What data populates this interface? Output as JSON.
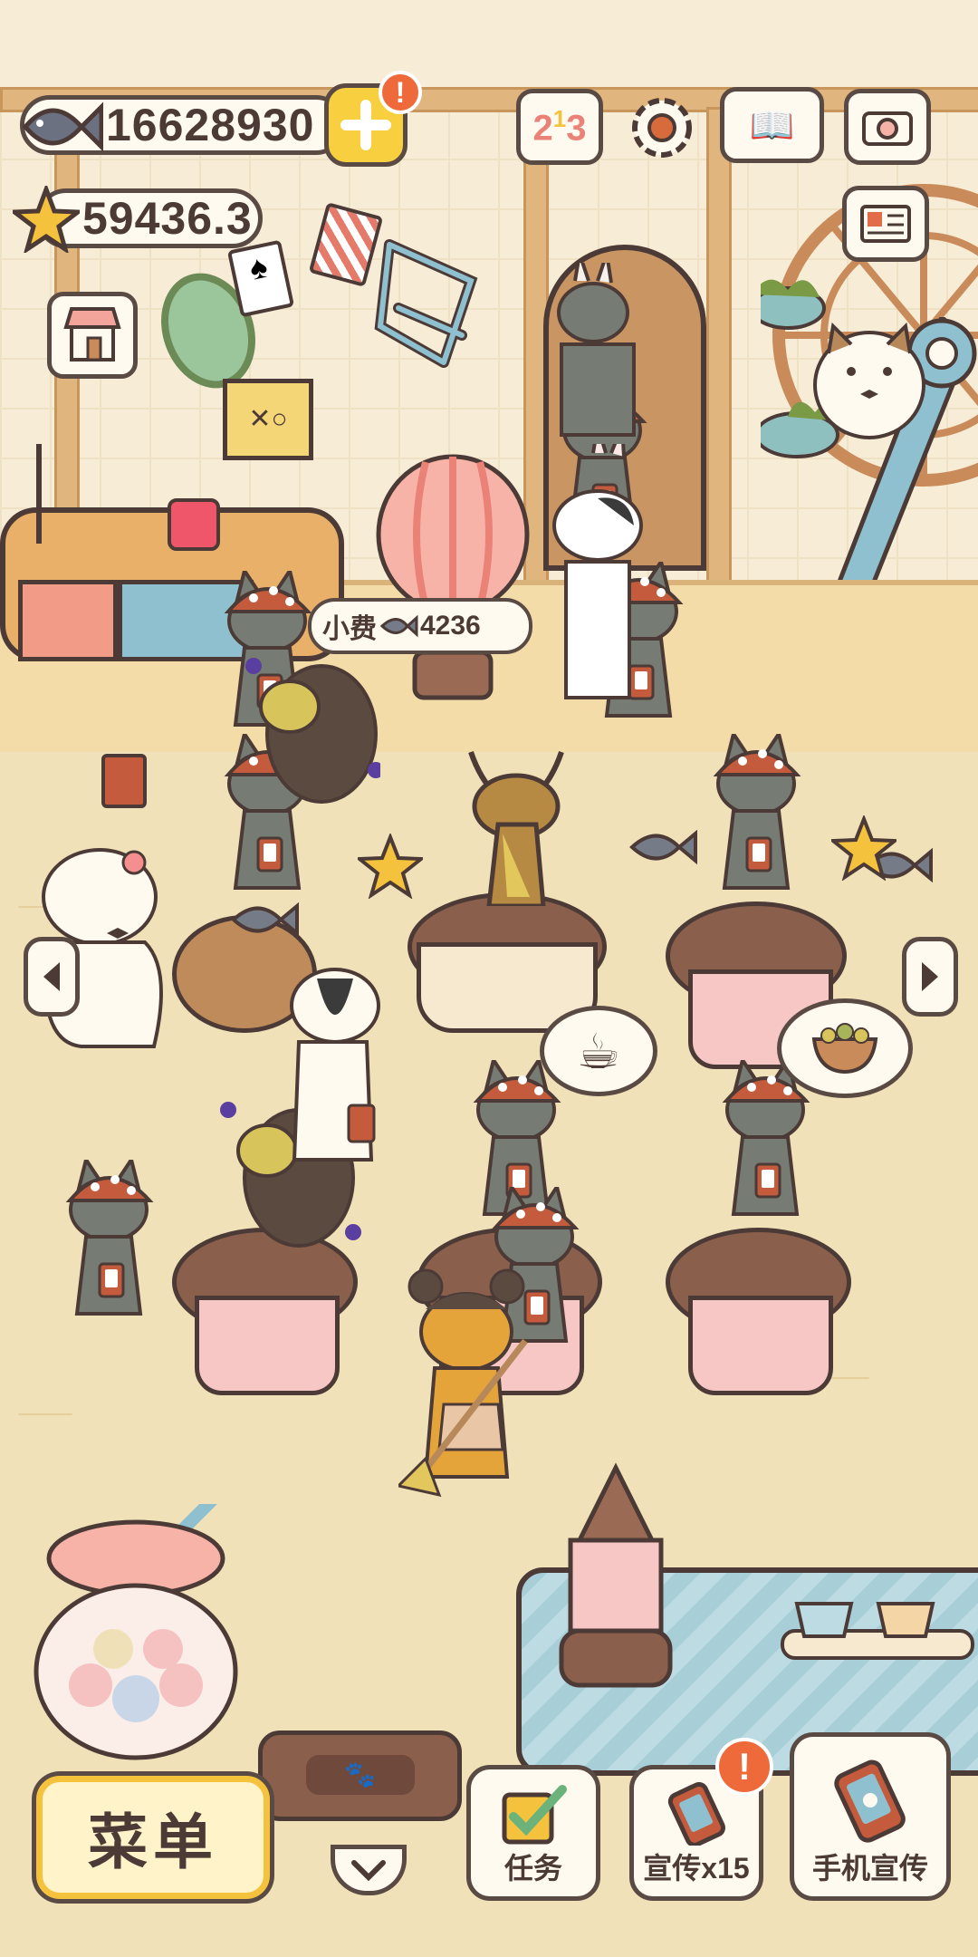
{
  "hud": {
    "fish_currency": "16628930",
    "star_currency": "59436.3",
    "plus_badge": "!"
  },
  "tip_bubble": {
    "label": "小费",
    "amount": "4236"
  },
  "top_icons": [
    "ranking-icon",
    "settings-icon",
    "book-icon",
    "camera-icon",
    "card-icon",
    "shop-icon"
  ],
  "bottom_bar": {
    "menu_label": "菜单",
    "tasks_label": "任务",
    "promote_label": "宣传x15",
    "promote_badge": "!",
    "phone_promote_label": "手机宣传"
  },
  "colors": {
    "accent_yellow": "#f8cf3e",
    "badge_orange": "#ef6a3a",
    "outline": "#5a4a44",
    "bg_cream": "#f3e3bd"
  }
}
